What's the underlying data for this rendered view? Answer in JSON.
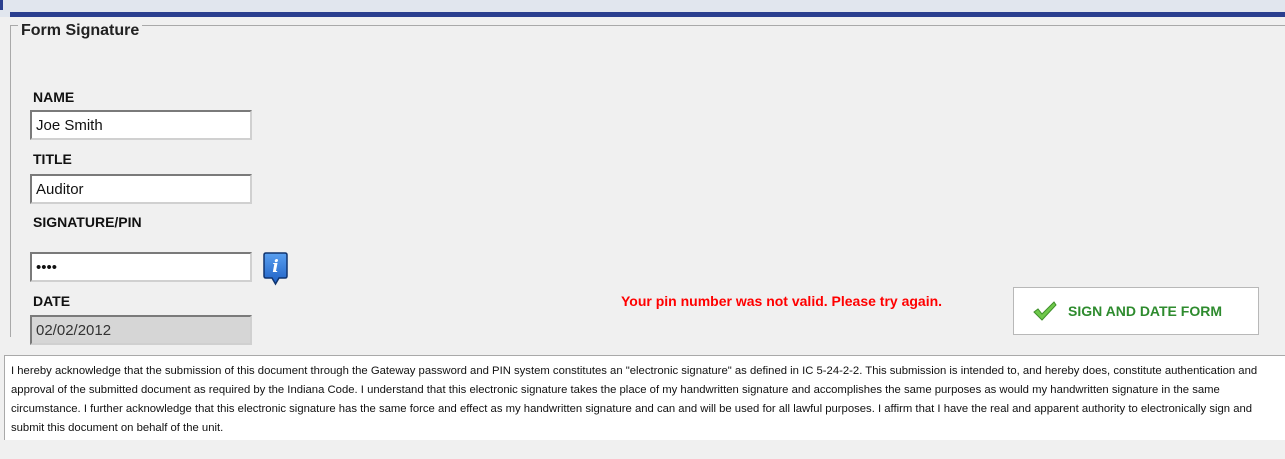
{
  "form": {
    "legend": "Form Signature",
    "name_label": "NAME",
    "name_value": "Joe Smith",
    "title_label": "TITLE",
    "title_value": "Auditor",
    "pin_label": "SIGNATURE/PIN",
    "pin_value": "abcd",
    "date_label": "DATE",
    "date_value": "02/02/2012",
    "info_icon": "info-icon"
  },
  "status": {
    "error_message": "Your pin number was not valid. Please try again.",
    "error_color": "#ff0000"
  },
  "actions": {
    "sign_label": "SIGN AND DATE FORM",
    "sign_icon": "checkmark-icon",
    "accent_color": "#2e8b2e"
  },
  "disclaimer": {
    "text": "I hereby acknowledge that the submission of this document through the Gateway password and PIN system constitutes an \"electronic signature\" as defined in IC 5-24-2-2. This submission is intended to, and hereby does, constitute authentication and approval of the submitted document as required by the Indiana Code. I understand that this electronic signature takes the place of my handwritten signature and accomplishes the same purposes as would my handwritten signature in the same circumstance. I further acknowledge that this electronic signature has the same force and effect as my handwritten signature and can and will be used for all lawful purposes. I affirm that I have the real and apparent authority to electronically sign and submit this document on behalf of the unit."
  },
  "theme": {
    "header_accent": "#2a3f8f",
    "panel_bg": "#f0f0f0"
  }
}
